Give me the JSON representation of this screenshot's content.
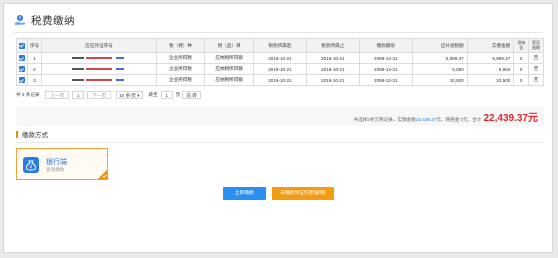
{
  "header": {
    "title": "税费缴纳"
  },
  "table": {
    "columns": [
      "序号",
      "应征凭证序号",
      "税（费）种",
      "税（品）目",
      "税款所属起",
      "税款所属止",
      "缴款期限",
      "应补退税额",
      "实缴金额",
      "滞纳金",
      "是否逾期"
    ],
    "rows": [
      {
        "index": "1",
        "tax_type": "企业所得税",
        "item": "应纳税所得额",
        "period_start": "2019-10-21",
        "period_end": "2019-10-21",
        "deadline": "2099-12-31",
        "due": "5,989.37",
        "paid": "5,989.37",
        "late_fee": "0",
        "overdue": "否"
      },
      {
        "index": "2",
        "tax_type": "企业所得税",
        "item": "应纳税所得额",
        "period_start": "2019-10-21",
        "period_end": "2019-10-21",
        "deadline": "2099-12-31",
        "due": "5,950",
        "paid": "5,950",
        "late_fee": "0",
        "overdue": "否"
      },
      {
        "index": "3",
        "tax_type": "企业所得税",
        "item": "应纳税所得额",
        "period_start": "2019-10-21",
        "period_end": "2019-10-21",
        "deadline": "2099-12-31",
        "due": "10,500",
        "paid": "10,500",
        "late_fee": "0",
        "overdue": "否"
      }
    ]
  },
  "pager": {
    "total": "共 3 条记录",
    "prev": "上一页",
    "page": "1",
    "next": "下一页",
    "page_size": "10 条/页",
    "goto_prefix": "跳至",
    "goto_value": "1",
    "goto_suffix": "页",
    "confirm": "前 转"
  },
  "summary": {
    "prefix": "共选择3条欠税记录，实缴金额",
    "paid_amount": "22,439.37",
    "mid": "元，网络金 0元，合计",
    "total": "22,439.37元"
  },
  "payment": {
    "section_title": "缴款方式",
    "bank_name": "银行端",
    "bank_sub": "查询缴款"
  },
  "actions": {
    "pay_now": "立即缴款",
    "print_voucher": "未缴款凭证作废(解锁)"
  },
  "colors": {
    "accent": "#2a7ae4",
    "orange": "#f08c00",
    "total_red": "#e4252a"
  },
  "icons": {
    "logo": "coin-hand-icon",
    "checkbox": "checkbox-checked-icon",
    "bank": "bank-money-bag-icon"
  }
}
